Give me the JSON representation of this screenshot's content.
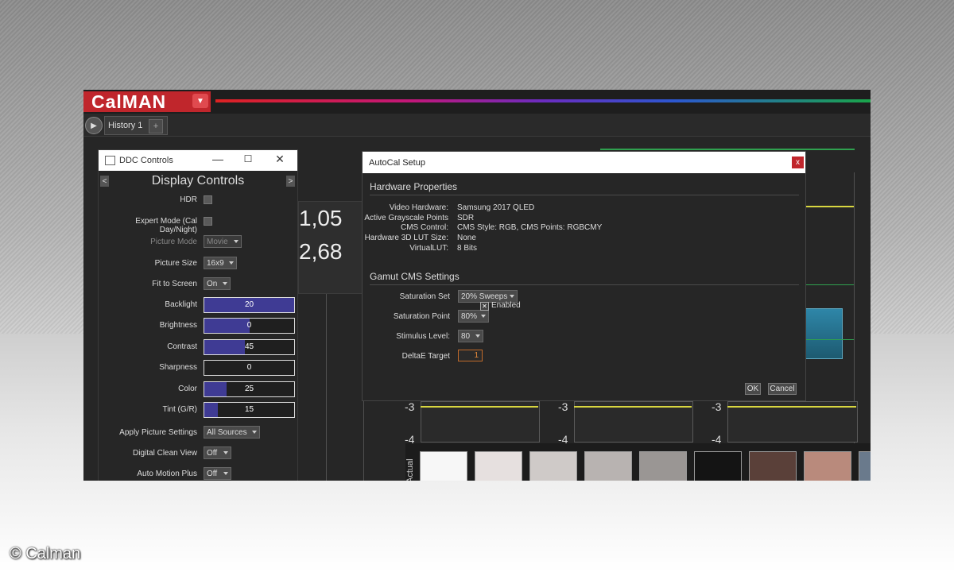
{
  "app": {
    "logo_text": "CalMAN",
    "tab_label": "History 1",
    "add_tab": "+"
  },
  "readout": {
    "line1": "1,05",
    "line2": "2,68"
  },
  "charts": {
    "y_labels": [
      "-3",
      "-4"
    ],
    "swatch_axis_label": "Actual",
    "swatches": [
      "#f7f7f7",
      "#e6e0df",
      "#cfcac8",
      "#b8b3b1",
      "#9a9694",
      "#141414",
      "#5a4039",
      "#b98a7c"
    ]
  },
  "ddc": {
    "window_title": "DDC Controls",
    "header": "Display Controls",
    "prev": "<",
    "next": ">",
    "hdr_label": "HDR",
    "expert_label": "Expert Mode (Cal Day/Night)",
    "picture_mode_label": "Picture Mode",
    "picture_mode_value": "Movie",
    "picture_size_label": "Picture Size",
    "picture_size_value": "16x9",
    "fit_label": "Fit to Screen",
    "fit_value": "On",
    "sliders": [
      {
        "label": "Backlight",
        "value": "20",
        "fraction": 1.0
      },
      {
        "label": "Brightness",
        "value": "0",
        "fraction": 0.5
      },
      {
        "label": "Contrast",
        "value": "45",
        "fraction": 0.45
      },
      {
        "label": "Sharpness",
        "value": "0",
        "fraction": 0.0
      },
      {
        "label": "Color",
        "value": "25",
        "fraction": 0.25
      },
      {
        "label": "Tint (G/R)",
        "value": "15",
        "fraction": 0.15
      }
    ],
    "apply_label": "Apply Picture Settings",
    "apply_value": "All Sources",
    "clean_label": "Digital Clean View",
    "clean_value": "Off",
    "motion_label": "Auto Motion Plus",
    "motion_value": "Off"
  },
  "autocal": {
    "title": "AutoCal Setup",
    "close": "x",
    "hw_heading": "Hardware Properties",
    "hw": [
      {
        "label": "Video Hardware:",
        "value": "Samsung 2017 QLED"
      },
      {
        "label": "Active Grayscale Points",
        "value": "SDR"
      },
      {
        "label": "CMS Control:",
        "value": "CMS Style: RGB, CMS Points: RGBCMY"
      },
      {
        "label": "Hardware 3D LUT Size:",
        "value": "None"
      },
      {
        "label": "VirtualLUT:",
        "value": "8 Bits"
      }
    ],
    "gamut_heading": "Gamut CMS Settings",
    "enabled_label": "Enabled",
    "enabled_check": "✕",
    "saturation_set_label": "Saturation Set",
    "saturation_set_value": "20% Sweeps",
    "saturation_point_label": "Saturation Point",
    "saturation_point_value": "80%",
    "stimulus_label": "Stimulus Level:",
    "stimulus_value": "80",
    "deltae_label": "DeltaE Target",
    "deltae_value": "1",
    "ok": "OK",
    "cancel": "Cancel"
  },
  "copyright": "© Calman"
}
